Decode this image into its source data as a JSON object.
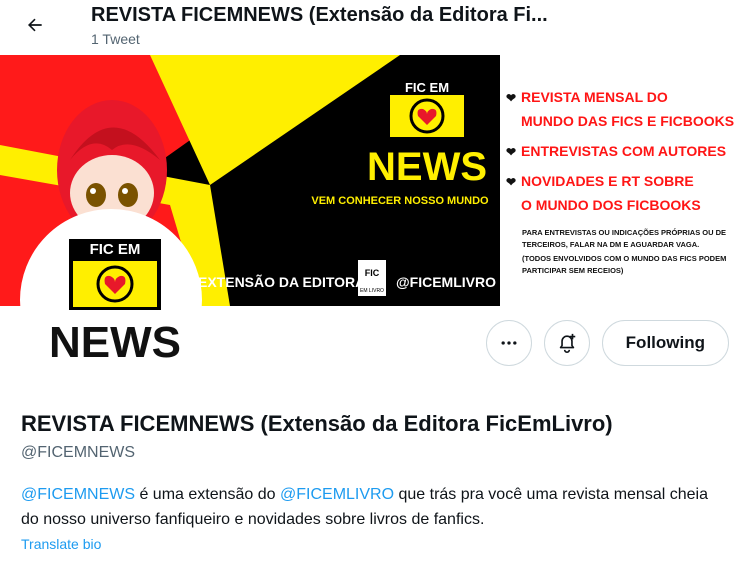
{
  "header": {
    "title": "REVISTA FICEMNEWS (Extensão da Editora Fi...",
    "tweet_count": "1 Tweet"
  },
  "banner": {
    "logo_top": "FIC EM",
    "logo_bottom": "NEWS",
    "tagline": "VEM CONHECER NOSSO MUNDO",
    "footer_left": "EXTENSÃO DA EDITORA",
    "footer_logo_top": "FIC",
    "footer_logo_bottom": "EM LIVRO",
    "footer_right": "@FICEMLIVRO",
    "bullets": [
      "REVISTA MENSAL DO MUNDO DAS FICS E FICBOOKS",
      "ENTREVISTAS COM AUTORES",
      "NOVIDADES E RT SOBRE O MUNDO DOS FICBOOKS"
    ],
    "bullet_lines": [
      [
        "REVISTA MENSAL DO",
        "MUNDO DAS FICS E FICBOOKS"
      ],
      [
        "ENTREVISTAS COM AUTORES"
      ],
      [
        "NOVIDADES E RT SOBRE",
        "O MUNDO DOS FICBOOKS"
      ]
    ],
    "note_lines": [
      "PARA ENTREVISTAS OU INDICAÇÕES PRÓPRIAS OU DE",
      "TERCEIROS, FALAR NA DM E AGUARDAR VAGA.",
      "(TODOS ENVOLVIDOS COM O MUNDO DAS FICS PODEM",
      "PARTICIPAR SEM RECEIOS)"
    ]
  },
  "avatar": {
    "logo_top": "FIC EM",
    "logo_bottom": "NEWS"
  },
  "actions": {
    "more_icon": "more-horizontal-icon",
    "notify_icon": "bell-plus-icon",
    "follow_label": "Following"
  },
  "profile": {
    "name": "REVISTA FICEMNEWS (Extensão da Editora FicEmLivro)",
    "handle": "@FICEMNEWS",
    "bio_mention_1": "@FICEMNEWS",
    "bio_text_1": " é uma extensão do ",
    "bio_mention_2": "@FICEMLIVRO",
    "bio_text_2": " que trás pra você uma revista mensal cheia do nosso universo fanfiqueiro e novidades sobre livros de fanfics.",
    "translate_label": "Translate bio"
  },
  "colors": {
    "accent": "#1d9bf0",
    "banner_red": "#ff1a1a",
    "banner_yellow": "#ffef00",
    "banner_black": "#000000",
    "banner_text_red": "#ff1515"
  }
}
